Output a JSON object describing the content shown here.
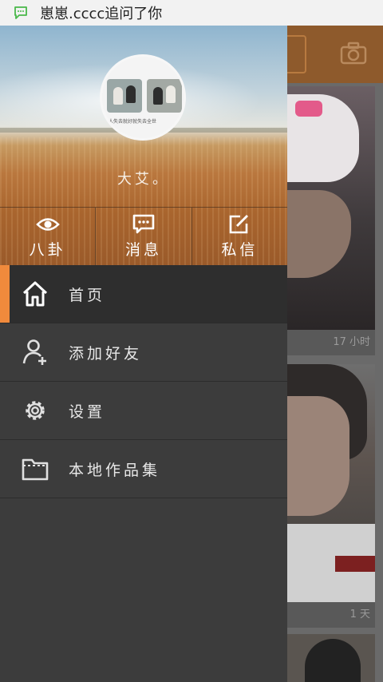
{
  "status_bar": {
    "notification_icon": "chat-bubble-icon",
    "notification_text": "崽崽.cccc追问了你"
  },
  "background_app": {
    "camera_icon": "camera-icon",
    "card1_time": "17 小时",
    "card2_time": "1 天"
  },
  "drawer": {
    "username": "大艾。",
    "avatar_caption": "人失去就好就失去全世",
    "tabs": [
      {
        "icon": "eye-icon",
        "label": "八卦"
      },
      {
        "icon": "message-icon",
        "label": "消息"
      },
      {
        "icon": "compose-icon",
        "label": "私信"
      }
    ],
    "menu": [
      {
        "icon": "home-icon",
        "label": "首页",
        "active": true
      },
      {
        "icon": "add-friend-icon",
        "label": "添加好友",
        "active": false
      },
      {
        "icon": "settings-gear-icon",
        "label": "设置",
        "active": false
      },
      {
        "icon": "folder-icon",
        "label": "本地作品集",
        "active": false
      }
    ]
  },
  "colors": {
    "accent": "#f08a3c",
    "drawer_bg": "#3c3c3c",
    "active_item_bg": "#2e2e2e"
  }
}
